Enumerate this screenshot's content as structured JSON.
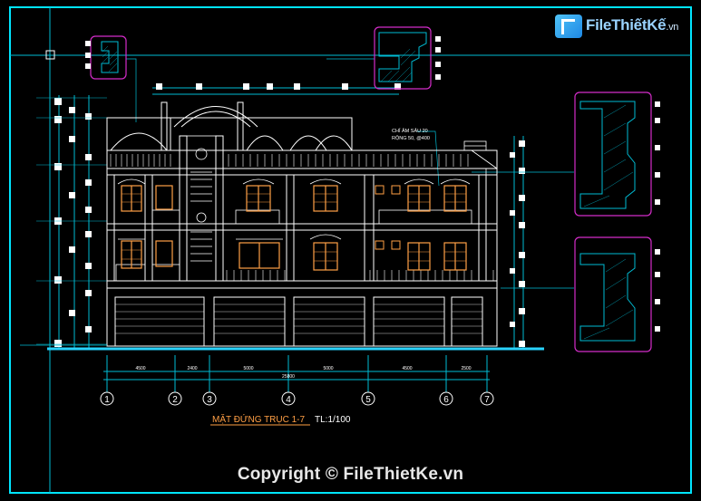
{
  "drawing": {
    "title": "MẶT ĐỨNG TRỤC 1-7",
    "scale": "TL:1/100",
    "note_line1": "CHỈ ÂM SÂU 20",
    "note_line2": "RỘNG 50, @400",
    "axes": [
      "1",
      "2",
      "3",
      "4",
      "5",
      "6",
      "7"
    ],
    "span_dims": [
      "4500",
      "2400",
      "5000",
      "5000",
      "4500",
      "2500"
    ],
    "total_dim": "25800"
  },
  "logo": {
    "name": "FileThiếtKế",
    "tld": ".vn"
  },
  "footer": {
    "copyright": "Copyright © FileThietKe.vn"
  },
  "colors": {
    "background": "#000000",
    "frame": "#00e5ff",
    "structure": "#ffffff",
    "dimension": "#00bcd4",
    "window": "#ff9f45",
    "detail_frame": "#d42cc9",
    "ground": "#29d3ff"
  }
}
